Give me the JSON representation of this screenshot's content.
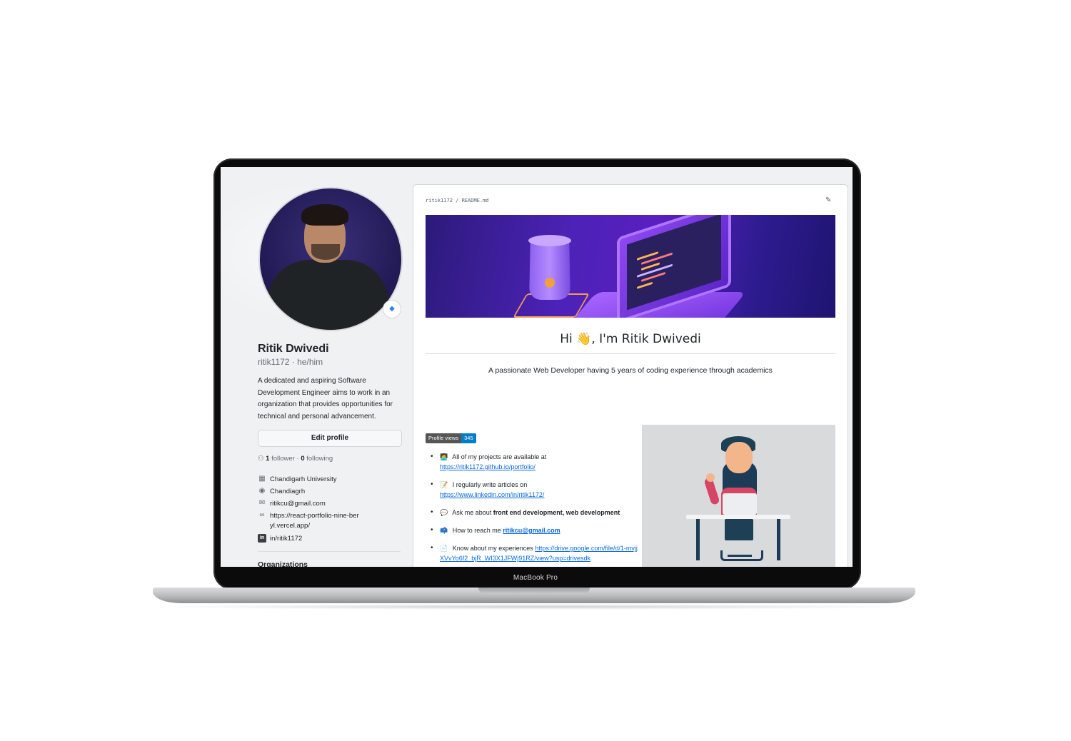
{
  "device": {
    "label": "MacBook Pro"
  },
  "profile": {
    "full_name": "Ritik Dwivedi",
    "handle": "ritik1172 · he/him",
    "bio": "A dedicated and aspiring Software Development Engineer aims to work in an organization that provides opportunities for technical and personal advancement.",
    "edit_button": "Edit profile",
    "followers_count": "1",
    "followers_label": "follower",
    "following_count": "0",
    "following_label": "following",
    "organization": "Chandigarh University",
    "location": "Chandiagrh",
    "email": "ritikcu@gmail.com",
    "website": "https://react-portfolio-nine-beryl.vercel.app/",
    "linkedin": "in/ritik1172",
    "organizations_title": "Organizations"
  },
  "readme": {
    "path_user": "ritik1172",
    "path_file": "README.md",
    "heading": "Hi 👋, I'm Ritik Dwivedi",
    "tagline": "A passionate Web Developer having 5 years of coding experience through academics",
    "views_badge_label": "Profile views",
    "views_badge_value": "345",
    "items": [
      {
        "emoji": "🧑‍💻",
        "text": "All of my projects are available at",
        "link": "https://ritik1172.github.io/portfolio/"
      },
      {
        "emoji": "📝",
        "text": "I regularly write articles on",
        "link": "https://www.linkedin.com/in/ritik1172/"
      },
      {
        "emoji": "💬",
        "text": "Ask me about",
        "bold": "front end development, web development"
      },
      {
        "emoji": "📫",
        "text": "How to reach me",
        "link": "ritikcu@gmail.com"
      },
      {
        "emoji": "📄",
        "text": "Know about my experiences",
        "link": "https://drive.google.com/file/d/1-mvjjXVvYo6f2_bjR_WI3X1JFWj91RZ/view?usp=drivesdk"
      }
    ]
  },
  "colors": {
    "link": "#0969da",
    "badge_value_bg": "#007ec6",
    "banner_purple": "#4c22b8"
  },
  "icons": {
    "organization": "building-icon",
    "location": "location-pin-icon",
    "email": "mail-icon",
    "website": "link-icon",
    "linkedin": "linkedin-icon",
    "followers": "people-icon",
    "edit": "pencil-icon",
    "status": "status-emoji-icon"
  }
}
